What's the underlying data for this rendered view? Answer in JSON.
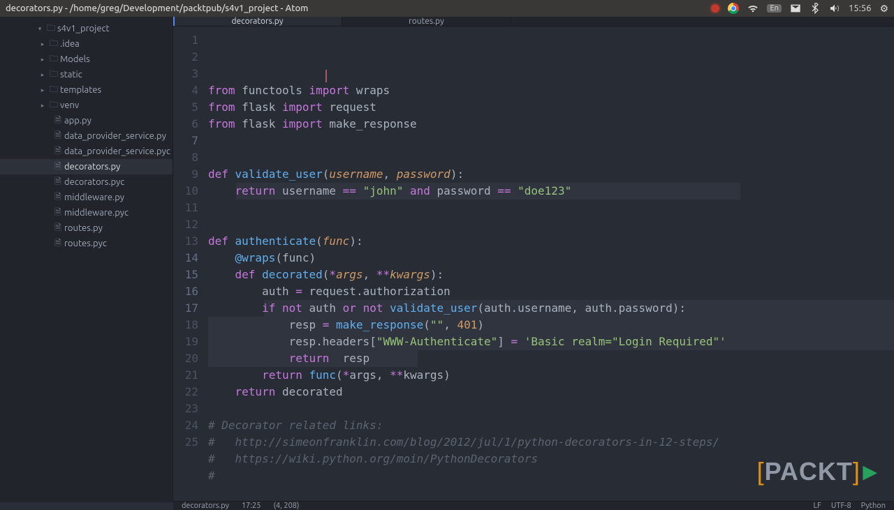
{
  "window": {
    "title": "decorators.py - /home/greg/Development/packtpub/s4v1_project - Atom"
  },
  "tray": {
    "lang": "En",
    "time": "15:56"
  },
  "project": {
    "name": "s4v1_project",
    "folders": [
      ".idea",
      "Models",
      "static",
      "templates",
      "venv"
    ],
    "files": [
      "app.py",
      "data_provider_service.py",
      "data_provider_service.pyc",
      "decorators.py",
      "decorators.pyc",
      "middleware.py",
      "middleware.pyc",
      "routes.py",
      "routes.pyc"
    ],
    "active_file": "decorators.py"
  },
  "tabs": [
    {
      "label": "decorators.py",
      "active": true
    },
    {
      "label": "routes.py",
      "active": false
    }
  ],
  "code": {
    "lines": [
      [
        [
          "kw",
          "from"
        ],
        [
          "plain",
          " functools "
        ],
        [
          "kw",
          "import"
        ],
        [
          "plain",
          " wraps"
        ]
      ],
      [
        [
          "kw",
          "from"
        ],
        [
          "plain",
          " flask "
        ],
        [
          "kw",
          "import"
        ],
        [
          "plain",
          " request"
        ]
      ],
      [
        [
          "kw",
          "from"
        ],
        [
          "plain",
          " flask "
        ],
        [
          "kw",
          "import"
        ],
        [
          "plain",
          " make_response"
        ]
      ],
      [],
      [],
      [
        [
          "kw",
          "def"
        ],
        [
          "plain",
          " "
        ],
        [
          "fn",
          "validate_user"
        ],
        [
          "plain",
          "("
        ],
        [
          "arg",
          "username"
        ],
        [
          "plain",
          ", "
        ],
        [
          "arg",
          "password"
        ],
        [
          "plain",
          "):"
        ]
      ],
      [
        [
          "plain",
          "    "
        ],
        [
          "kw",
          "return"
        ],
        [
          "plain",
          " username "
        ],
        [
          "op",
          "=="
        ],
        [
          "plain",
          " "
        ],
        [
          "str",
          "\"john\""
        ],
        [
          "plain",
          " "
        ],
        [
          "op",
          "and"
        ],
        [
          "plain",
          " password "
        ],
        [
          "op",
          "=="
        ],
        [
          "plain",
          " "
        ],
        [
          "str",
          "\"doe123\""
        ]
      ],
      [],
      [],
      [
        [
          "kw",
          "def"
        ],
        [
          "plain",
          " "
        ],
        [
          "fn",
          "authenticate"
        ],
        [
          "plain",
          "("
        ],
        [
          "arg",
          "func"
        ],
        [
          "plain",
          "):"
        ]
      ],
      [
        [
          "plain",
          "    "
        ],
        [
          "deco",
          "@wraps"
        ],
        [
          "plain",
          "(func)"
        ]
      ],
      [
        [
          "plain",
          "    "
        ],
        [
          "kw",
          "def"
        ],
        [
          "plain",
          " "
        ],
        [
          "fn",
          "decorated"
        ],
        [
          "plain",
          "("
        ],
        [
          "op",
          "*"
        ],
        [
          "arg",
          "args"
        ],
        [
          "plain",
          ", "
        ],
        [
          "op",
          "**"
        ],
        [
          "arg",
          "kwargs"
        ],
        [
          "plain",
          "):"
        ]
      ],
      [
        [
          "plain",
          "        auth "
        ],
        [
          "op",
          "="
        ],
        [
          "plain",
          " request.authorization"
        ]
      ],
      [
        [
          "plain",
          "        "
        ],
        [
          "kw",
          "if"
        ],
        [
          "plain",
          " "
        ],
        [
          "op",
          "not"
        ],
        [
          "plain",
          " auth "
        ],
        [
          "op",
          "or"
        ],
        [
          "plain",
          " "
        ],
        [
          "op",
          "not"
        ],
        [
          "plain",
          " "
        ],
        [
          "fn",
          "validate_user"
        ],
        [
          "plain",
          "(auth.username, auth.password):"
        ]
      ],
      [
        [
          "plain",
          "            resp "
        ],
        [
          "op",
          "="
        ],
        [
          "plain",
          " "
        ],
        [
          "fn",
          "make_response"
        ],
        [
          "plain",
          "("
        ],
        [
          "str",
          "\"\""
        ],
        [
          "plain",
          ", "
        ],
        [
          "num",
          "401"
        ],
        [
          "plain",
          ")"
        ]
      ],
      [
        [
          "plain",
          "            resp.headers["
        ],
        [
          "str",
          "\"WWW-Authenticate\""
        ],
        [
          "plain",
          "] "
        ],
        [
          "op",
          "="
        ],
        [
          "plain",
          " "
        ],
        [
          "str",
          "'Basic realm=\"Login Required\"'"
        ]
      ],
      [
        [
          "plain",
          "            "
        ],
        [
          "kw",
          "return"
        ],
        [
          "plain",
          "  resp"
        ]
      ],
      [
        [
          "plain",
          "        "
        ],
        [
          "kw",
          "return"
        ],
        [
          "plain",
          " "
        ],
        [
          "fn",
          "func"
        ],
        [
          "plain",
          "("
        ],
        [
          "op",
          "*"
        ],
        [
          "plain",
          "args, "
        ],
        [
          "op",
          "**"
        ],
        [
          "plain",
          "kwargs)"
        ]
      ],
      [
        [
          "plain",
          "    "
        ],
        [
          "kw",
          "return"
        ],
        [
          "plain",
          " decorated"
        ]
      ],
      [],
      [
        [
          "cmt",
          "# Decorator related links:"
        ]
      ],
      [
        [
          "cmt",
          "#   http://simeonfranklin.com/blog/2012/jul/1/python-decorators-in-12-steps/"
        ]
      ],
      [
        [
          "cmt",
          "#   https://wiki.python.org/moin/PythonDecorators"
        ]
      ],
      [
        [
          "cmt",
          "#"
        ]
      ],
      []
    ],
    "selection_highlight_lines": [
      7,
      14,
      15,
      16,
      17
    ]
  },
  "status": {
    "file": "decorators.py",
    "cursor_time": "17:25",
    "pos": "(4, 208)",
    "encoding": "UTF-8",
    "eol": "LF",
    "lang": "Python"
  },
  "logo": "PACKT"
}
